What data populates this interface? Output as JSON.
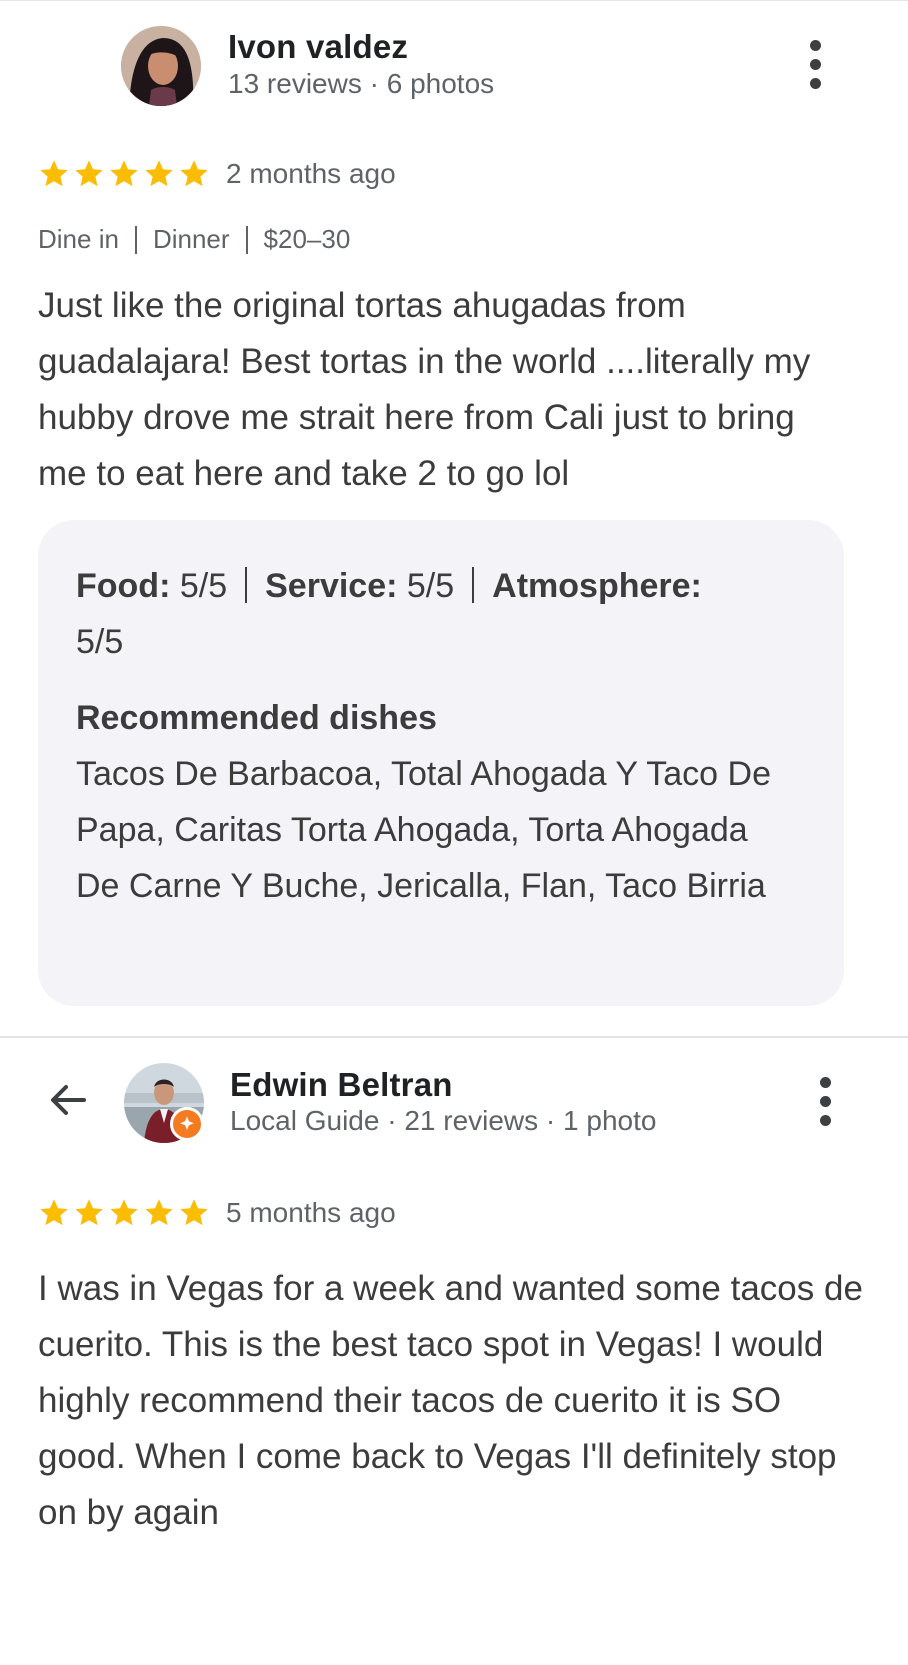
{
  "reviews": [
    {
      "author": "Ivon valdez",
      "stats": "13 reviews · 6 photos",
      "rating": 5,
      "time": "2 months ago",
      "tags": [
        "Dine in",
        "Dinner",
        "$20–30"
      ],
      "text": "Just like the original tortas ahugadas from guadalajara! Best tortas in the world ....literally my hubby drove me strait here from Cali just to bring me to eat here and take 2 to go lol",
      "details": {
        "food_label": "Food:",
        "food_value": " 5/5",
        "service_label": "Service:",
        "service_value": " 5/5",
        "atmosphere_label": "Atmosphere:",
        "atmosphere_value": "5/5",
        "recommended_label": "Recommended dishes",
        "recommended_value": "Tacos De Barbacoa, Total Ahogada Y Taco De Papa, Caritas Torta Ahogada, Torta Ahogada De Carne Y Buche, Jericalla, Flan, Taco Birria"
      }
    },
    {
      "author": "Edwin Beltran",
      "stats": "Local Guide · 21 reviews · 1 photo",
      "rating": 5,
      "time": "5 months ago",
      "text": "I was in Vegas for a week and wanted some tacos de cuerito. This is the best taco spot in Vegas! I would highly recommend their tacos de cuerito it is SO good. When I come back to Vegas I'll definitely stop on by again"
    }
  ],
  "icons": {
    "star": "star-icon",
    "more": "more-vert-icon",
    "back": "arrow-back-icon",
    "local_guide": "local-guide-badge-icon"
  },
  "colors": {
    "star": "#fbbc04",
    "local_guide": "#f47b20",
    "card_bg": "#f4f4f8"
  }
}
